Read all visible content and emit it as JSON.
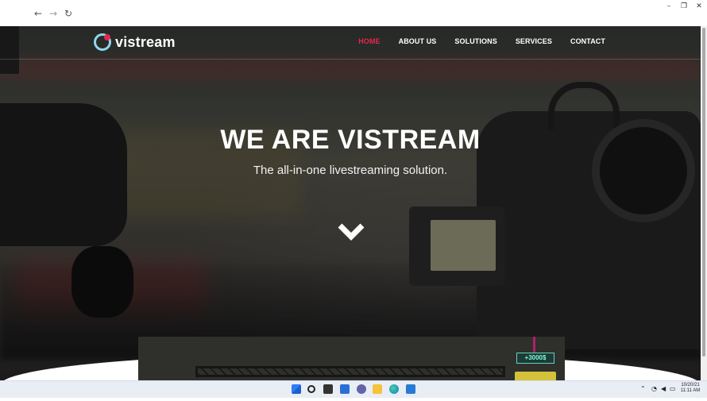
{
  "browser": {
    "back_icon": "arrow-left-icon",
    "forward_icon": "arrow-right-icon",
    "refresh_icon": "refresh-icon",
    "window_controls": [
      "minimize-icon",
      "restore-icon",
      "close-icon"
    ]
  },
  "site": {
    "logo_text": "vistream",
    "nav": [
      {
        "label": "HOME",
        "active": true
      },
      {
        "label": "ABOUT US",
        "active": false
      },
      {
        "label": "SOLUTIONS",
        "active": false
      },
      {
        "label": "SERVICES",
        "active": false
      },
      {
        "label": "CONTACT",
        "active": false
      }
    ],
    "hero": {
      "title": "WE ARE VISTREAM",
      "subtitle": "The all-in-one livestreaming solution.",
      "scroll_icon": "chevron-down-icon"
    },
    "preview": {
      "screen_text": "+3000$"
    }
  },
  "colors": {
    "accent": "#e8254f",
    "logo_ring": "#8fd8ea",
    "taskbar": "#e9eef5"
  },
  "taskbar": {
    "icons": [
      "start-icon",
      "search-icon",
      "task-view-icon",
      "widgets-icon",
      "chat-icon",
      "edge-icon",
      "file-explorer-icon",
      "store-icon"
    ],
    "tray": [
      "chevron-up-icon",
      "wifi-icon",
      "volume-icon",
      "battery-icon"
    ],
    "date": "10/20/21",
    "time": "11:11 AM"
  }
}
